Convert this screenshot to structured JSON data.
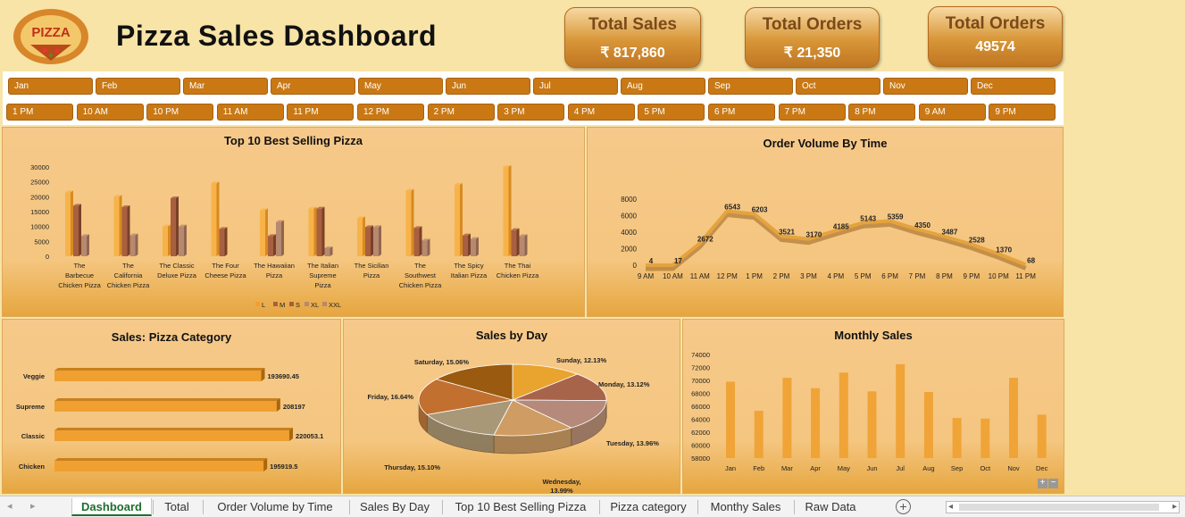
{
  "header": {
    "logo_text": "PIZZA",
    "title": "Pizza Sales Dashboard",
    "kpis": [
      {
        "title": "Total Sales",
        "value": "₹ 817,860"
      },
      {
        "title": "Total Orders",
        "value": "₹ 21,350"
      },
      {
        "title": "Total Orders",
        "value": "49574"
      }
    ]
  },
  "slicers": {
    "months": [
      "Jan",
      "Feb",
      "Mar",
      "Apr",
      "May",
      "Jun",
      "Jul",
      "Aug",
      "Sep",
      "Oct",
      "Nov",
      "Dec"
    ],
    "hours": [
      "1 PM",
      "10 AM",
      "10 PM",
      "11 AM",
      "11 PM",
      "12 PM",
      "2 PM",
      "3 PM",
      "4 PM",
      "5 PM",
      "6 PM",
      "7 PM",
      "8 PM",
      "9 AM",
      "9 PM"
    ]
  },
  "colors": {
    "L": "#f0a030",
    "M": "#a86040",
    "S": "#a35e3c",
    "XL": "#b7896e",
    "XXL": "#b7896e"
  },
  "chart_data": [
    {
      "type": "bar",
      "title": "Top 10 Best Selling Pizza",
      "categories": [
        "The Barbecue Chicken Pizza",
        "The California Chicken Pizza",
        "The Classic Deluxe Pizza",
        "The Four Cheese Pizza",
        "The Hawaiian Pizza",
        "The Italian Supreme Pizza",
        "The Sicilian Pizza",
        "The Southwest Chicken Pizza",
        "The Spicy Italian Pizza",
        "The Thai Chicken Pizza"
      ],
      "category_lines": [
        [
          "The",
          "Barbecue",
          "Chicken Pizza"
        ],
        [
          "The",
          "California",
          "Chicken Pizza"
        ],
        [
          "The Classic",
          "Deluxe Pizza"
        ],
        [
          "The Four",
          "Cheese Pizza"
        ],
        [
          "The Hawaiian",
          "Pizza"
        ],
        [
          "The Italian",
          "Supreme",
          "Pizza"
        ],
        [
          "The Sicilian",
          "Pizza"
        ],
        [
          "The",
          "Southwest",
          "Chicken Pizza"
        ],
        [
          "The Spicy",
          "Italian Pizza"
        ],
        [
          "The Thai",
          "Chicken Pizza"
        ]
      ],
      "series": [
        {
          "name": "L",
          "values": [
            21500,
            20000,
            10000,
            24500,
            15500,
            16000,
            12800,
            22000,
            24000,
            30000
          ]
        },
        {
          "name": "M",
          "values": [
            17000,
            16500,
            19500,
            9200,
            6800,
            16000,
            9800,
            9500,
            7000,
            8800
          ]
        },
        {
          "name": "S",
          "values": [
            6800,
            7000,
            10000,
            0,
            11500,
            2700,
            9800,
            5300,
            5800,
            6800
          ]
        },
        {
          "name": "XL",
          "values": [
            0,
            0,
            0,
            0,
            0,
            0,
            0,
            0,
            0,
            0
          ]
        },
        {
          "name": "XXL",
          "values": [
            0,
            0,
            0,
            0,
            0,
            0,
            0,
            0,
            0,
            0
          ]
        }
      ],
      "ylim": [
        0,
        30000
      ],
      "yticks": [
        0,
        5000,
        10000,
        15000,
        20000,
        25000,
        30000
      ],
      "legend": "bottom"
    },
    {
      "type": "line",
      "title": "Order Volume By Time",
      "x": [
        "9 AM",
        "10 AM",
        "11 AM",
        "12 PM",
        "1 PM",
        "2 PM",
        "3 PM",
        "4 PM",
        "5 PM",
        "6 PM",
        "7 PM",
        "8 PM",
        "9 PM",
        "10 PM",
        "11 PM"
      ],
      "values": [
        4,
        17,
        2672,
        6543,
        6203,
        3521,
        3170,
        4185,
        5143,
        5359,
        4350,
        3487,
        2528,
        1370,
        68
      ],
      "ylim": [
        0,
        8000
      ],
      "yticks": [
        0,
        2000,
        4000,
        6000,
        8000
      ]
    },
    {
      "type": "bar",
      "orientation": "horizontal",
      "title": "Sales: Pizza Category",
      "categories": [
        "Veggie",
        "Supreme",
        "Classic",
        "Chicken"
      ],
      "values": [
        193690.45,
        208197,
        220053.1,
        195919.5
      ],
      "value_labels": [
        "193690.45",
        "208197",
        "220053.1",
        "195919.5"
      ]
    },
    {
      "type": "pie",
      "title": "Sales by Day",
      "slices": [
        {
          "label": "Sunday, 12.13%",
          "value": 12.13,
          "color": "#e8a42e"
        },
        {
          "label": "Monday, 13.12%",
          "value": 13.12,
          "color": "#a8644a"
        },
        {
          "label": "Tuesday, 13.96%",
          "value": 13.96,
          "color": "#b58a7a"
        },
        {
          "label": "Wednesday, 13.99%",
          "value": 13.99,
          "color": "#cf9c64"
        },
        {
          "label": "Thursday, 15.10%",
          "value": 15.1,
          "color": "#a89878"
        },
        {
          "label": "Friday, 16.64%",
          "value": 16.64,
          "color": "#c17030"
        },
        {
          "label": "Saturday, 15.06%",
          "value": 15.06,
          "color": "#9a5a10"
        }
      ]
    },
    {
      "type": "bar",
      "title": "Monthly Sales",
      "categories": [
        "Jan",
        "Feb",
        "Mar",
        "Apr",
        "May",
        "Jun",
        "Jul",
        "Aug",
        "Sep",
        "Oct",
        "Nov",
        "Dec"
      ],
      "values": [
        69800,
        65300,
        70400,
        68800,
        71200,
        68300,
        72500,
        68200,
        64200,
        64100,
        70400,
        64700
      ],
      "ylim": [
        58000,
        74000
      ],
      "yticks": [
        58000,
        60000,
        62000,
        64000,
        66000,
        68000,
        70000,
        72000,
        74000
      ]
    }
  ],
  "sheet_tabs": [
    "Dashboard",
    "Total",
    "Order Volume by Time",
    "Sales By Day",
    "Top 10 Best Selling Pizza",
    "Pizza category",
    "Monthy Sales",
    "Raw Data"
  ]
}
